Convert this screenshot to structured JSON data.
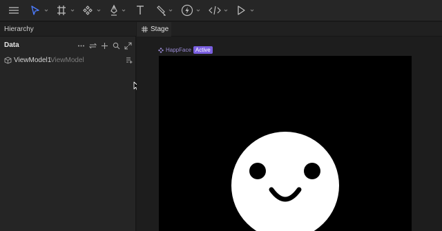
{
  "toolbar": {
    "tools": [
      {
        "name": "menu-icon"
      },
      {
        "name": "select-pointer-icon",
        "color": "#4d7dff"
      },
      {
        "name": "artboard-frame-icon"
      },
      {
        "name": "component-diamond-icon"
      },
      {
        "name": "pen-icon"
      },
      {
        "name": "text-icon"
      },
      {
        "name": "brush-icon"
      },
      {
        "name": "lightning-icon"
      },
      {
        "name": "code-icon"
      },
      {
        "name": "play-icon"
      }
    ]
  },
  "hierarchy": {
    "title": "Hierarchy"
  },
  "data_panel": {
    "title": "Data",
    "actions": [
      "more-icon",
      "swap-icon",
      "add-icon",
      "search-icon",
      "expand-icon"
    ],
    "viewmodel": {
      "name": "ViewModel1",
      "type": "ViewModel"
    }
  },
  "stage": {
    "tab_label": "Stage",
    "artboard_name": "HappFace",
    "artboard_badge": "Active",
    "accent_color": "#7a5fe0"
  }
}
